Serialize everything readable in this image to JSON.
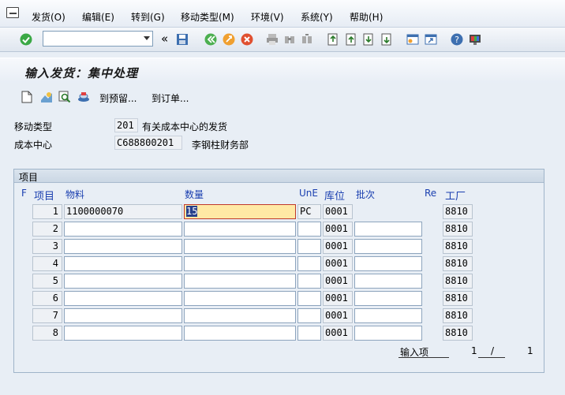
{
  "menu": [
    {
      "label": "发货(O)"
    },
    {
      "label": "编辑(E)"
    },
    {
      "label": "转到(G)"
    },
    {
      "label": "移动类型(M)"
    },
    {
      "label": "环境(V)"
    },
    {
      "label": "系统(Y)"
    },
    {
      "label": "帮助(H)"
    }
  ],
  "toolbar": {
    "command_field_value": "",
    "nav_back_symbol": "«"
  },
  "header": {
    "title": "输入发货：集中处理"
  },
  "app_toolbar": {
    "to_reservation": "到预留...",
    "to_order": "到订单..."
  },
  "form": {
    "movement_type_label": "移动类型",
    "movement_type_value": "201",
    "movement_type_text": "有关成本中心的发货",
    "cost_center_label": "成本中心",
    "cost_center_value": "C688800201",
    "cost_center_text": "李钢柱财务部"
  },
  "items_panel": {
    "title": "项目",
    "columns": {
      "f": "F",
      "item": "项目",
      "material": "物料",
      "quantity": "数量",
      "une": "UnE",
      "storage_location": "库位",
      "batch": "批次",
      "re": "Re",
      "plant": "工厂"
    },
    "rows": [
      {
        "item": "1",
        "material": "1100000070",
        "quantity": "15",
        "une": "PC",
        "sloc": "0001",
        "batch": "",
        "plant": "8810"
      },
      {
        "item": "2",
        "material": "",
        "quantity": "",
        "une": "",
        "sloc": "0001",
        "batch": "",
        "plant": "8810"
      },
      {
        "item": "3",
        "material": "",
        "quantity": "",
        "une": "",
        "sloc": "0001",
        "batch": "",
        "plant": "8810"
      },
      {
        "item": "4",
        "material": "",
        "quantity": "",
        "une": "",
        "sloc": "0001",
        "batch": "",
        "plant": "8810"
      },
      {
        "item": "5",
        "material": "",
        "quantity": "",
        "une": "",
        "sloc": "0001",
        "batch": "",
        "plant": "8810"
      },
      {
        "item": "6",
        "material": "",
        "quantity": "",
        "une": "",
        "sloc": "0001",
        "batch": "",
        "plant": "8810"
      },
      {
        "item": "7",
        "material": "",
        "quantity": "",
        "une": "",
        "sloc": "0001",
        "batch": "",
        "plant": "8810"
      },
      {
        "item": "8",
        "material": "",
        "quantity": "",
        "une": "",
        "sloc": "0001",
        "batch": "",
        "plant": "8810"
      }
    ],
    "footer": {
      "entry_label": "输入项",
      "current": "1",
      "separator": "/",
      "total": "1"
    }
  }
}
